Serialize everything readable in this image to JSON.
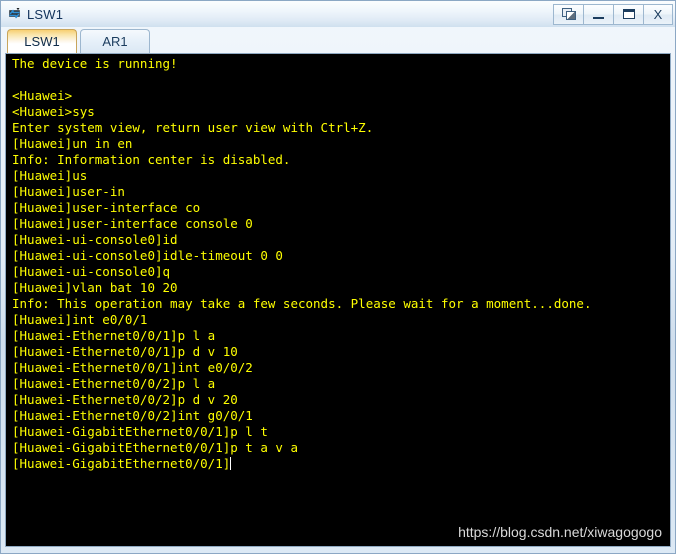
{
  "window": {
    "title": "LSW1",
    "icon": "switch-device-icon",
    "controls": [
      {
        "name": "restore-button",
        "glyph": "",
        "kind": "restore"
      },
      {
        "name": "minimize-button",
        "glyph": "",
        "kind": "minimize"
      },
      {
        "name": "maximize-button",
        "glyph": "",
        "kind": "maximize"
      },
      {
        "name": "close-button",
        "glyph": "X",
        "kind": "close"
      }
    ]
  },
  "tabs": [
    {
      "label": "LSW1",
      "active": true
    },
    {
      "label": "AR1",
      "active": false
    }
  ],
  "terminal": {
    "background_color": "#000000",
    "text_color": "#ffff00",
    "cursor_visible": true,
    "lines": [
      "The device is running!",
      "",
      "<Huawei>",
      "<Huawei>sys",
      "Enter system view, return user view with Ctrl+Z.",
      "[Huawei]un in en",
      "Info: Information center is disabled.",
      "[Huawei]us",
      "[Huawei]user-in",
      "[Huawei]user-interface co",
      "[Huawei]user-interface console 0",
      "[Huawei-ui-console0]id",
      "[Huawei-ui-console0]idle-timeout 0 0",
      "[Huawei-ui-console0]q",
      "[Huawei]vlan bat 10 20",
      "Info: This operation may take a few seconds. Please wait for a moment...done.",
      "[Huawei]int e0/0/1",
      "[Huawei-Ethernet0/0/1]p l a",
      "[Huawei-Ethernet0/0/1]p d v 10",
      "[Huawei-Ethernet0/0/1]int e0/0/2",
      "[Huawei-Ethernet0/0/2]p l a",
      "[Huawei-Ethernet0/0/2]p d v 20",
      "[Huawei-Ethernet0/0/2]int g0/0/1",
      "[Huawei-GigabitEthernet0/0/1]p l t",
      "[Huawei-GigabitEthernet0/0/1]p t a v a",
      "[Huawei-GigabitEthernet0/0/1]"
    ]
  },
  "watermark": {
    "text": "https://blog.csdn.net/xiwagogogo"
  }
}
